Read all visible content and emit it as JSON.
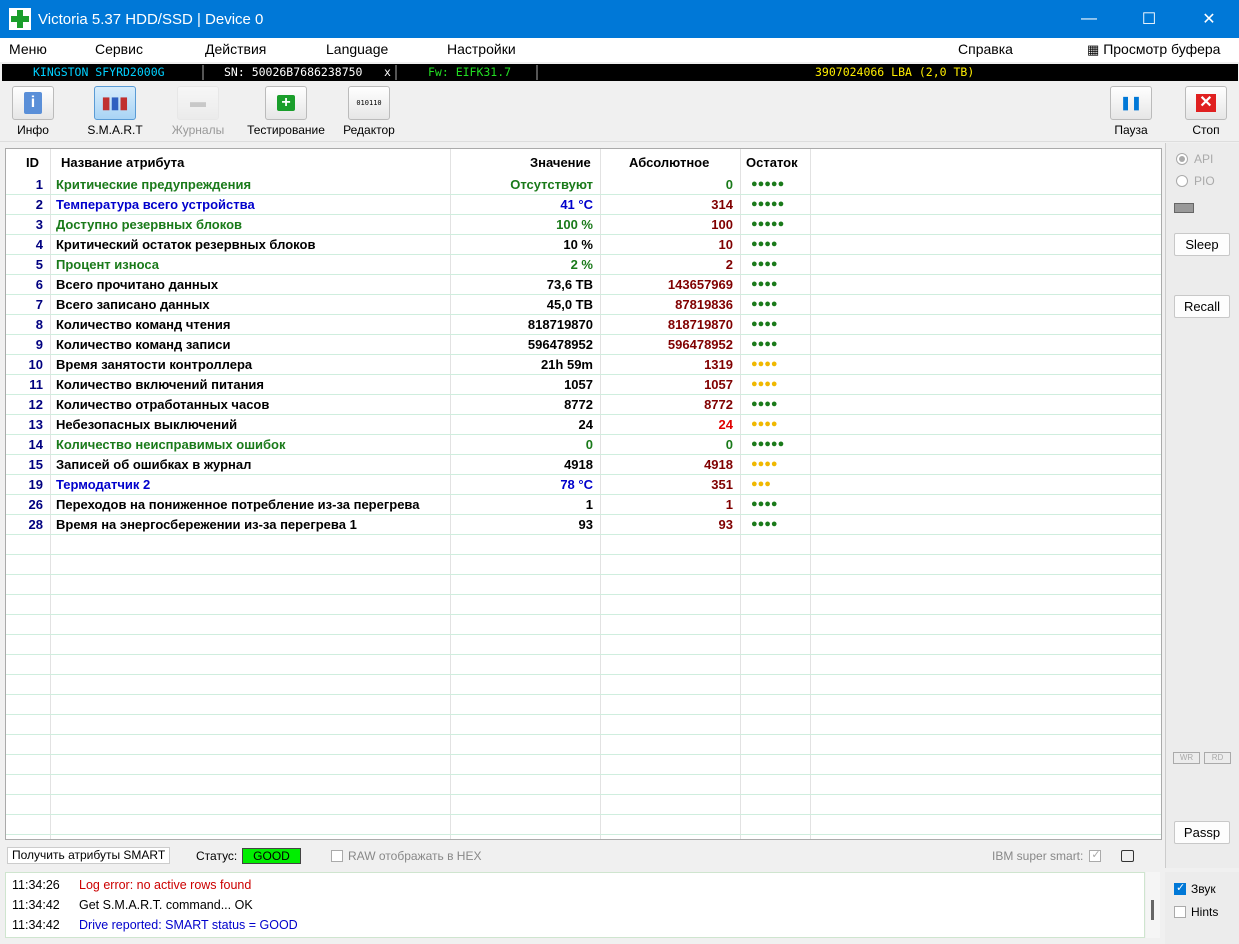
{
  "window": {
    "title": "Victoria 5.37 HDD/SSD | Device 0",
    "minimize": "—",
    "maximize": "☐",
    "close": "✕"
  },
  "menu": [
    "Меню",
    "Сервис",
    "Действия",
    "Language",
    "Настройки",
    "Справка",
    "Просмотр буфера"
  ],
  "device": {
    "model": "KINGSTON SFYRD2000G",
    "serial": "SN: 50026B7686238750",
    "x": "x",
    "firmware": "Fw: EIFK31.7",
    "lba": "3907024066 LBA (2,0 TB)"
  },
  "toolbar": {
    "info": "Инфо",
    "smart": "S.M.A.R.T",
    "logs": "Журналы",
    "testing": "Тестирование",
    "editor": "Редактор",
    "pause": "Пауза",
    "stop": "Стоп",
    "editor_icon_text": "010110"
  },
  "table": {
    "headers": {
      "id": "ID",
      "name": "Название атрибута",
      "value": "Значение",
      "absolute": "Абсолютное",
      "remaining": "Остаток"
    },
    "rows": [
      {
        "id": "1",
        "name": "Критические предупреждения",
        "value": "Отсутствуют",
        "abs": "0",
        "dots": "●●●●●",
        "name_color": "#1a7a1a",
        "value_color": "#1a7a1a",
        "abs_color": "#1a7a1a",
        "dot_color": "#1a7a1a"
      },
      {
        "id": "2",
        "name": "Температура всего устройства",
        "value": "41 °C",
        "abs": "314",
        "dots": "●●●●●",
        "name_color": "#0000cc",
        "value_color": "#0000cc",
        "abs_color": "#800000",
        "dot_color": "#1a7a1a"
      },
      {
        "id": "3",
        "name": "Доступно резервных блоков",
        "value": "100 %",
        "abs": "100",
        "dots": "●●●●●",
        "name_color": "#1a7a1a",
        "value_color": "#1a7a1a",
        "abs_color": "#800000",
        "dot_color": "#1a7a1a"
      },
      {
        "id": "4",
        "name": "Критический остаток резервных блоков",
        "value": "10 %",
        "abs": "10",
        "dots": "●●●●",
        "name_color": "#000000",
        "value_color": "#000000",
        "abs_color": "#800000",
        "dot_color": "#1a7a1a"
      },
      {
        "id": "5",
        "name": "Процент износа",
        "value": "2 %",
        "abs": "2",
        "dots": "●●●●",
        "name_color": "#1a7a1a",
        "value_color": "#1a7a1a",
        "abs_color": "#800000",
        "dot_color": "#1a7a1a"
      },
      {
        "id": "6",
        "name": "Всего прочитано данных",
        "value": "73,6 TB",
        "abs": "143657969",
        "dots": "●●●●",
        "name_color": "#000000",
        "value_color": "#000000",
        "abs_color": "#800000",
        "dot_color": "#1a7a1a"
      },
      {
        "id": "7",
        "name": "Всего записано данных",
        "value": "45,0 TB",
        "abs": "87819836",
        "dots": "●●●●",
        "name_color": "#000000",
        "value_color": "#000000",
        "abs_color": "#800000",
        "dot_color": "#1a7a1a"
      },
      {
        "id": "8",
        "name": "Количество команд чтения",
        "value": "818719870",
        "abs": "818719870",
        "dots": "●●●●",
        "name_color": "#000000",
        "value_color": "#000000",
        "abs_color": "#800000",
        "dot_color": "#1a7a1a"
      },
      {
        "id": "9",
        "name": "Количество команд записи",
        "value": "596478952",
        "abs": "596478952",
        "dots": "●●●●",
        "name_color": "#000000",
        "value_color": "#000000",
        "abs_color": "#800000",
        "dot_color": "#1a7a1a"
      },
      {
        "id": "10",
        "name": "Время занятости контроллера",
        "value": "21h 59m",
        "abs": "1319",
        "dots": "●●●●",
        "name_color": "#000000",
        "value_color": "#000000",
        "abs_color": "#800000",
        "dot_color": "#f0b800"
      },
      {
        "id": "11",
        "name": "Количество включений питания",
        "value": "1057",
        "abs": "1057",
        "dots": "●●●●",
        "name_color": "#000000",
        "value_color": "#000000",
        "abs_color": "#800000",
        "dot_color": "#f0b800"
      },
      {
        "id": "12",
        "name": "Количество отработанных часов",
        "value": "8772",
        "abs": "8772",
        "dots": "●●●●",
        "name_color": "#000000",
        "value_color": "#000000",
        "abs_color": "#800000",
        "dot_color": "#1a7a1a"
      },
      {
        "id": "13",
        "name": "Небезопасных выключений",
        "value": "24",
        "abs": "24",
        "dots": "●●●●",
        "name_color": "#000000",
        "value_color": "#000000",
        "abs_color": "#e00000",
        "dot_color": "#f0b800"
      },
      {
        "id": "14",
        "name": "Количество неисправимых ошибок",
        "value": "0",
        "abs": "0",
        "dots": "●●●●●",
        "name_color": "#1a7a1a",
        "value_color": "#1a7a1a",
        "abs_color": "#1a7a1a",
        "dot_color": "#1a7a1a"
      },
      {
        "id": "15",
        "name": "Записей об ошибках в журнал",
        "value": "4918",
        "abs": "4918",
        "dots": "●●●●",
        "name_color": "#000000",
        "value_color": "#000000",
        "abs_color": "#800000",
        "dot_color": "#f0b800"
      },
      {
        "id": "19",
        "name": "Термодатчик 2",
        "value": "78 °C",
        "abs": "351",
        "dots": "●●●",
        "name_color": "#0000cc",
        "value_color": "#0000cc",
        "abs_color": "#800000",
        "dot_color": "#f0b800"
      },
      {
        "id": "26",
        "name": "Переходов на пониженное потребление из-за перегрева",
        "value": "1",
        "abs": "1",
        "dots": "●●●●",
        "name_color": "#000000",
        "value_color": "#000000",
        "abs_color": "#800000",
        "dot_color": "#1a7a1a"
      },
      {
        "id": "28",
        "name": "Время на энергосбережении из-за перегрева 1",
        "value": "93",
        "abs": "93",
        "dots": "●●●●",
        "name_color": "#000000",
        "value_color": "#000000",
        "abs_color": "#800000",
        "dot_color": "#1a7a1a"
      }
    ]
  },
  "right_panel": {
    "api": "API",
    "pio": "PIO",
    "sleep": "Sleep",
    "recall": "Recall",
    "wr": "WR",
    "rd": "RD",
    "passp": "Passp"
  },
  "status_row": {
    "get_smart": "Получить атрибуты SMART",
    "status_label": "Статус:",
    "status_value": "GOOD",
    "raw_hex": "RAW отображать в HEX",
    "ibm": "IBM super smart:"
  },
  "log": [
    {
      "time": "11:34:26",
      "msg": "Log error: no active rows found",
      "color": "#cc0000"
    },
    {
      "time": "11:34:42",
      "msg": "Get S.M.A.R.T. command... OK",
      "color": "#000000"
    },
    {
      "time": "11:34:42",
      "msg": "Drive reported: SMART status = GOOD",
      "color": "#0000cc"
    }
  ],
  "log_options": {
    "sound": "Звук",
    "hints": "Hints"
  },
  "colors": {
    "titlebar": "#0078d7",
    "good": "#00ee00",
    "model": "#00d0ff",
    "serial": "#ffffff",
    "firmware": "#22dd22",
    "lba": "#ffee00"
  }
}
